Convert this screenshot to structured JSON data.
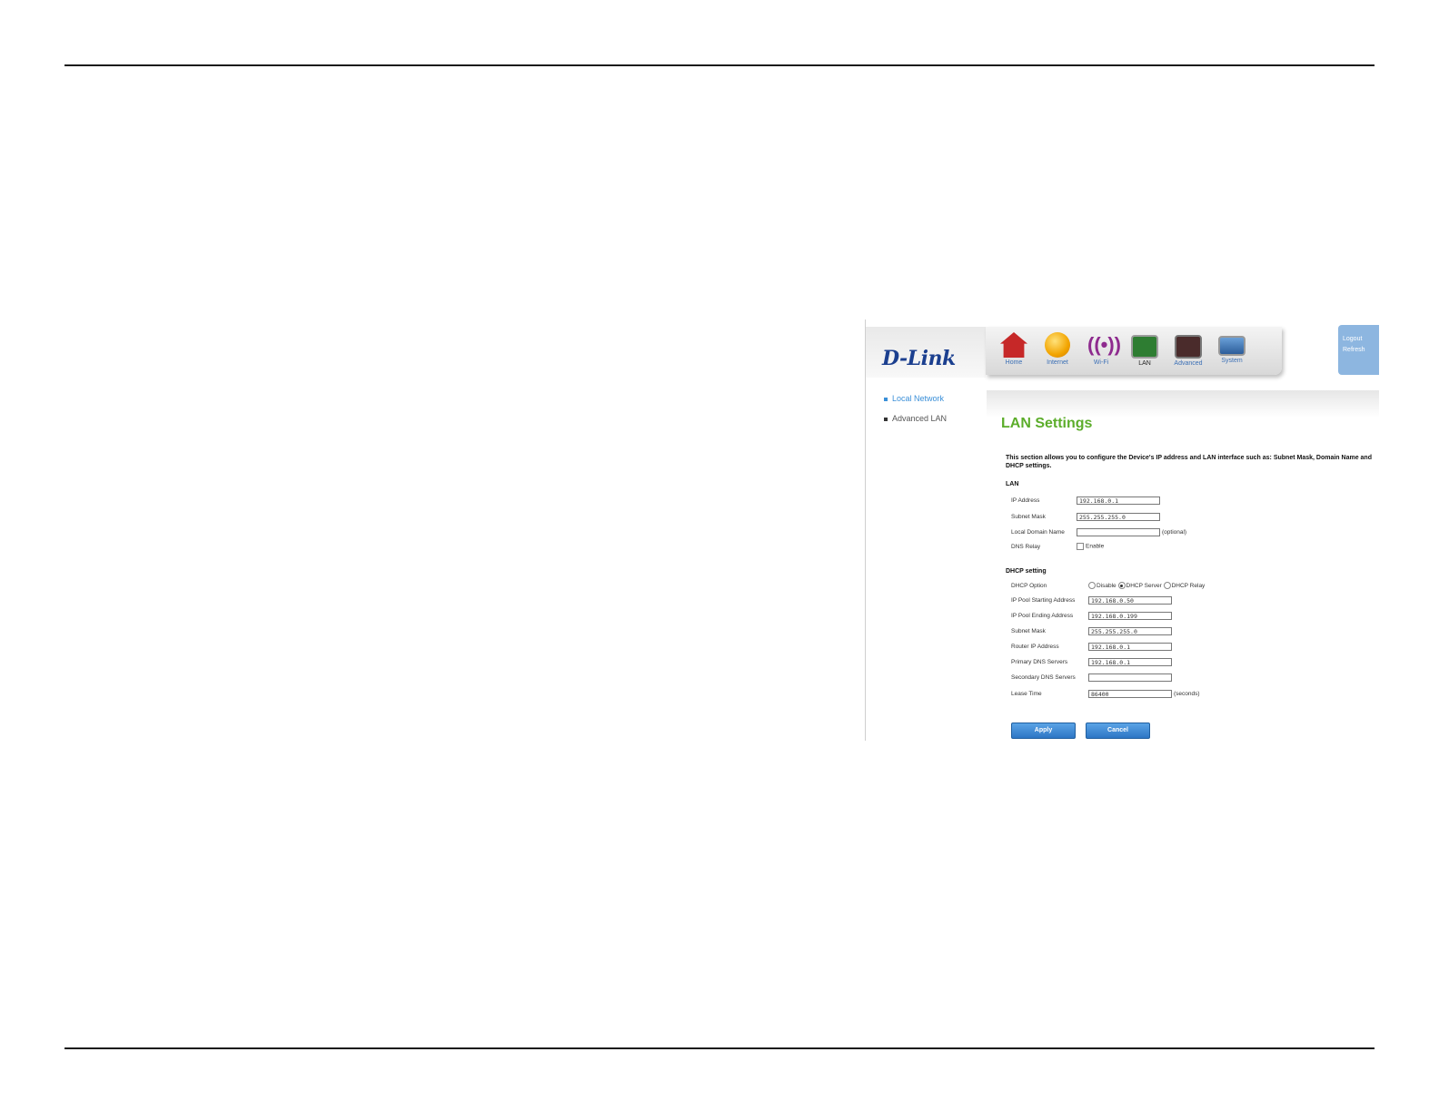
{
  "brand": "D-Link",
  "nav": [
    {
      "label": "Home",
      "icon": "home-icon"
    },
    {
      "label": "Internet",
      "icon": "globe-icon"
    },
    {
      "label": "Wi-Fi",
      "icon": "wifi-icon"
    },
    {
      "label": "LAN",
      "icon": "lan-icon"
    },
    {
      "label": "Advanced",
      "icon": "tools-icon"
    },
    {
      "label": "System",
      "icon": "monitor-icon"
    }
  ],
  "top_links": {
    "logout": "Logout",
    "refresh": "Refresh"
  },
  "sidebar": {
    "items": [
      {
        "label": "Local Network"
      },
      {
        "label": "Advanced LAN"
      }
    ]
  },
  "page": {
    "title": "LAN Settings",
    "description": "This section allows you to configure the Device's IP address and LAN interface such as: Subnet Mask, Domain Name and DHCP settings."
  },
  "lan": {
    "heading": "LAN",
    "ip_label": "IP Address",
    "ip_value": "192.168.0.1",
    "mask_label": "Subnet Mask",
    "mask_value": "255.255.255.0",
    "domain_label": "Local Domain Name",
    "domain_value": "",
    "domain_note": "(optional)",
    "dns_relay_label": "DNS Relay",
    "dns_relay_option": "Enable"
  },
  "dhcp": {
    "heading": "DHCP setting",
    "option_label": "DHCP Option",
    "options": [
      "Disable",
      "DHCP Server",
      "DHCP Relay"
    ],
    "selected": "DHCP Server",
    "start_label": "IP Pool Starting Address",
    "start_value": "192.168.0.50",
    "end_label": "IP Pool Ending Address",
    "end_value": "192.168.0.199",
    "mask_label": "Subnet Mask",
    "mask_value": "255.255.255.0",
    "router_label": "Router IP Address",
    "router_value": "192.168.0.1",
    "dns1_label": "Primary DNS Servers",
    "dns1_value": "192.168.0.1",
    "dns2_label": "Secondary DNS Servers",
    "dns2_value": "",
    "lease_label": "Lease Time",
    "lease_value": "86400",
    "lease_note": "(seconds)"
  },
  "buttons": {
    "apply": "Apply",
    "cancel": "Cancel"
  },
  "colors": {
    "title_green": "#5cad2b",
    "link_blue": "#3a8fd8",
    "button_blue": "#2d76c5"
  }
}
